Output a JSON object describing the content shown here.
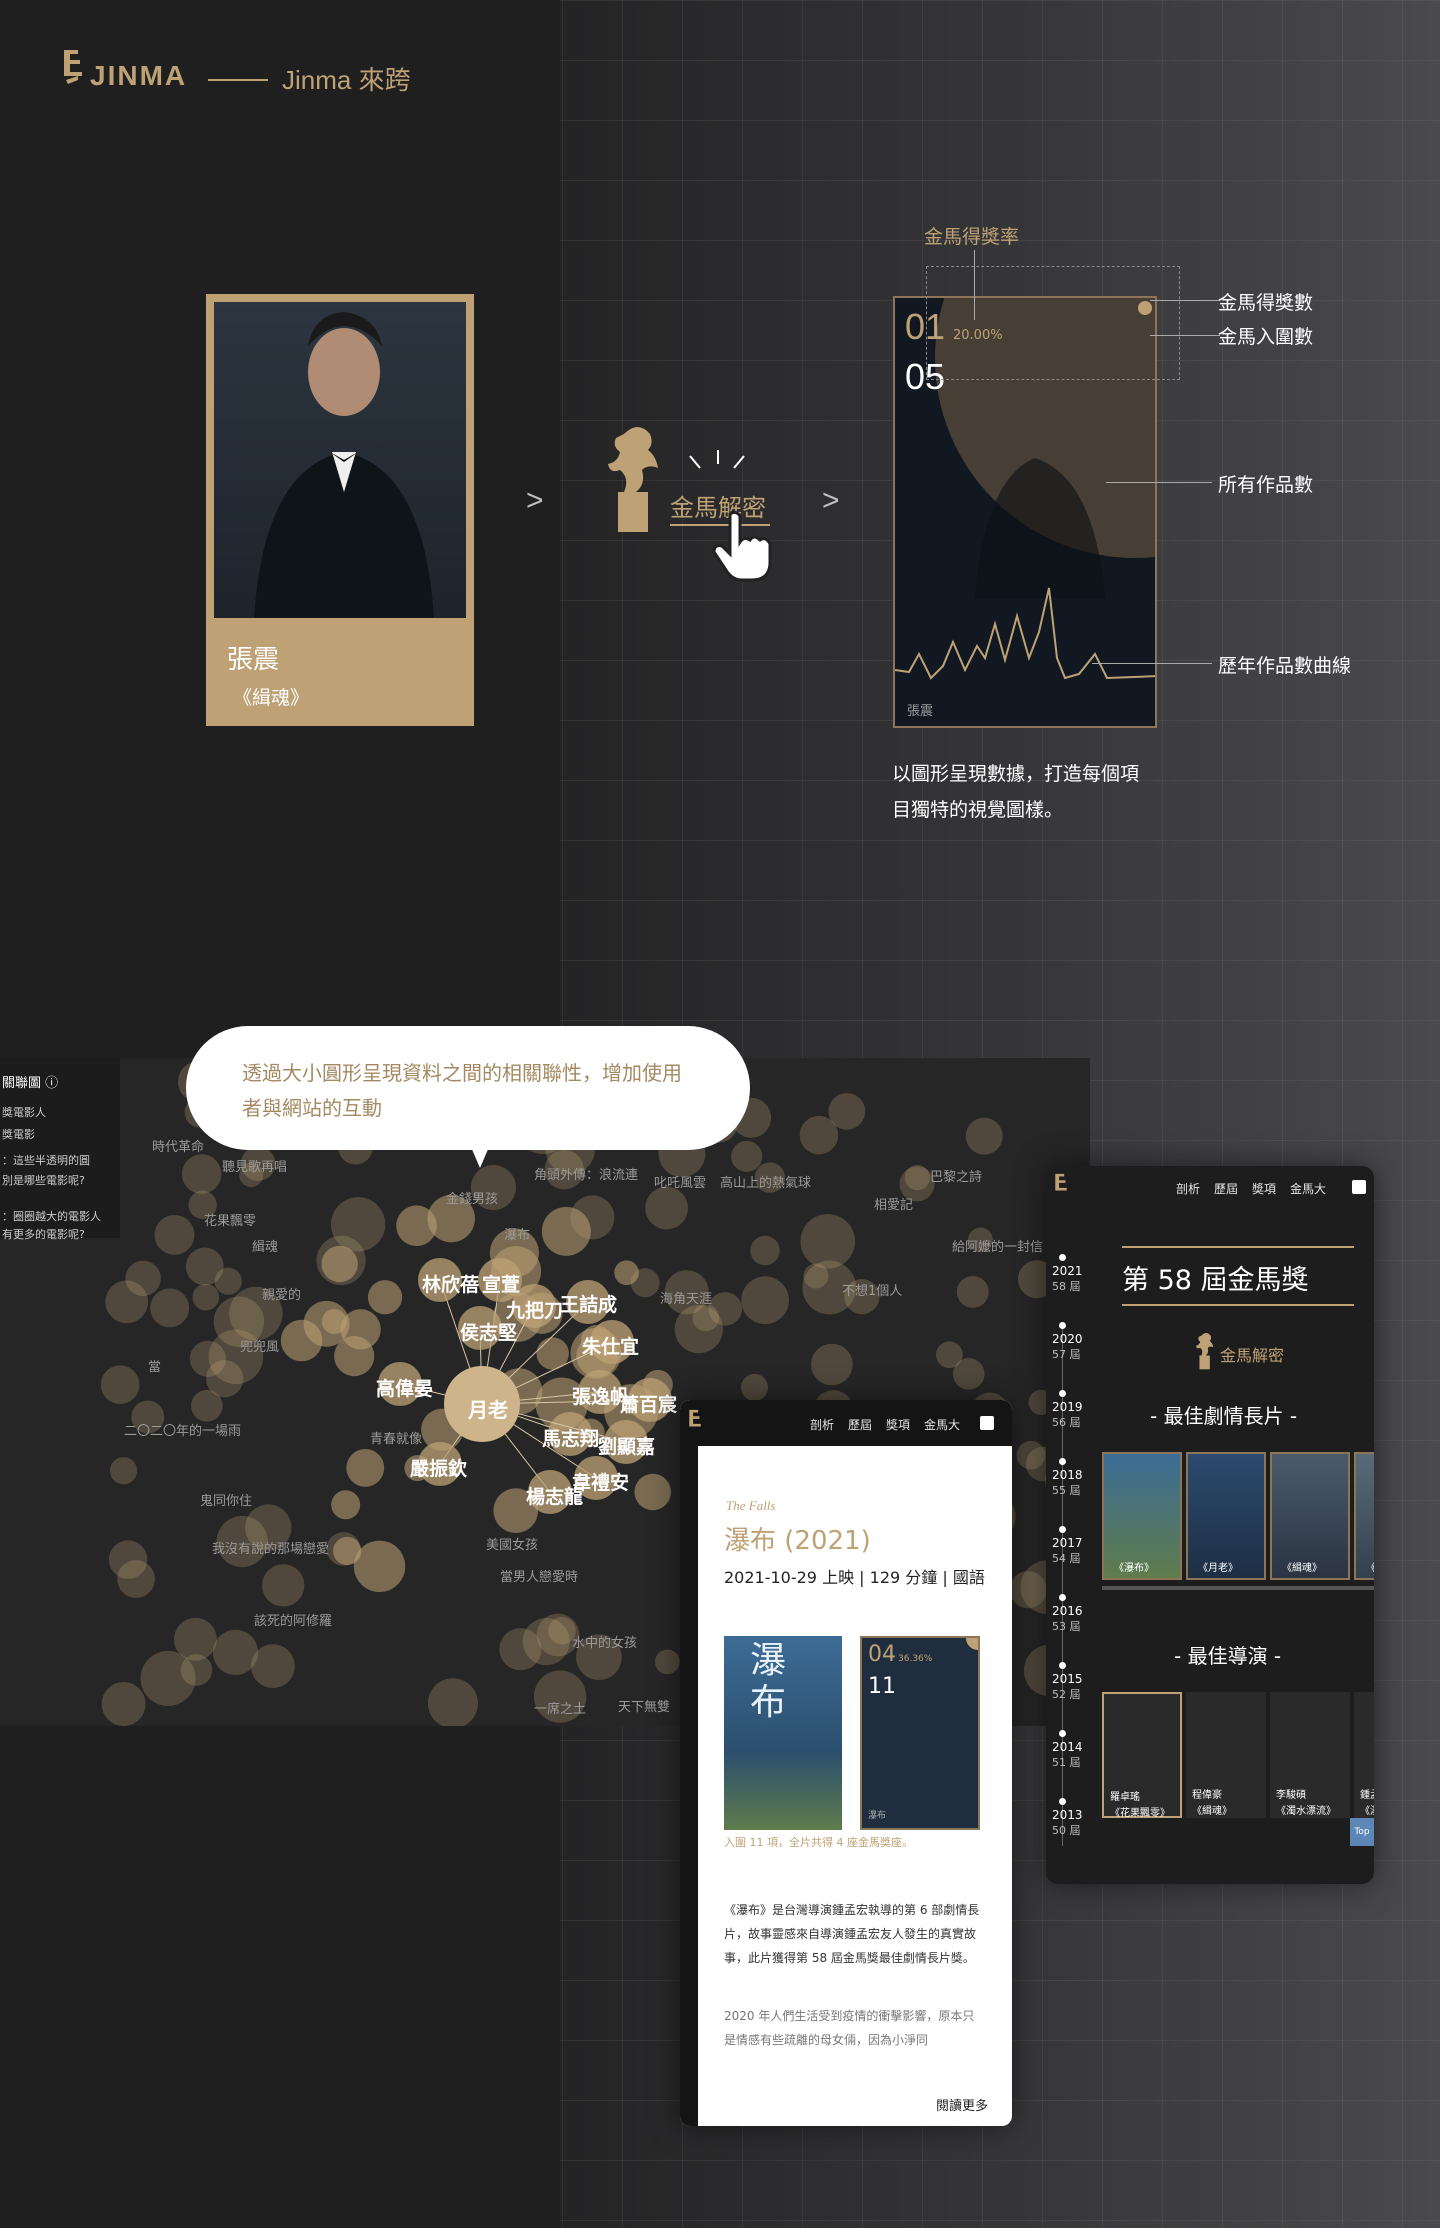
{
  "header": {
    "brand": "JINMA",
    "site_title": "Jinma 來跨"
  },
  "card": {
    "name": "張震",
    "work": "《緝魂》"
  },
  "flow": {
    "arrow": ">",
    "decode_label": "金馬解密"
  },
  "stat_card": {
    "awards": "01",
    "award_rate": "20.00%",
    "nominations": "05",
    "name": "張震"
  },
  "annotations": {
    "award_rate": "金馬得獎率",
    "awards": "金馬得獎數",
    "nominations": "金馬入圍數",
    "works": "所有作品數",
    "curve": "歷年作品數曲線"
  },
  "description": {
    "line1": "以圖形呈現數據，打造每個項",
    "line2": "目獨特的視覺圖樣。"
  },
  "bubble": {
    "line1": "透過大小圓形呈現資料之間的相關聯性，增加使用",
    "line2": "者與網站的互動"
  },
  "network": {
    "panel_title": "關聯圖 ⓘ",
    "panel_items": [
      "獎電影人",
      "獎電影",
      "：這些半透明的圓",
      "別是哪些電影呢?",
      "：圈圈越大的電影人",
      "有更多的電影呢?"
    ],
    "hub": "月老",
    "hot_names": [
      "林欣蓓",
      "宣萱",
      "九把刀",
      "王詰成",
      "侯志堅",
      "朱仕宜",
      "高偉晏",
      "張逸帆",
      "蕭百宸",
      "馬志翔",
      "劉顯嘉",
      "嚴振欽",
      "韋禮安",
      "楊志龍"
    ],
    "faded_titles": [
      "時代革命",
      "聽見歌再唱",
      "金錢男孩",
      "角頭外傳：浪流連",
      "叱吒風雲",
      "高山上的熱氣球",
      "巴黎之詩",
      "相愛記",
      "花果飄零",
      "瀑布",
      "給阿嬤的一封信",
      "緝魂",
      "親愛的",
      "不想1個人",
      "海角天涯",
      "兜兜風",
      "當",
      "二〇二〇年的一場雨",
      "青春就像",
      "鬼同你住",
      "美國女孩",
      "我沒有說的那場戀愛",
      "當男人戀愛時",
      "該死的阿修羅",
      "水中的女孩",
      "一席之土",
      "天下無雙"
    ]
  },
  "phone": {
    "nav": [
      "剖析",
      "歷屆",
      "獎項",
      "金馬大"
    ],
    "en_title": "The Falls",
    "title": "瀑布 (2021)",
    "meta": "2021-10-29 上映 | 129 分鐘 | 國語",
    "poster_text": "瀑布",
    "card_awards": "04",
    "card_rate": "36.36%",
    "card_noms": "11",
    "card_name": "瀑布",
    "note": "入圍 11 項，全片共得 4 座金馬獎座。",
    "body1": "《瀑布》是台灣導演鍾孟宏執導的第 6 部劇情長片，故事靈感來自導演鍾孟宏友人發生的真實故事，此片獲得第 58 屆金馬獎最佳劇情長片獎。",
    "body2": "2020 年人們生活受到疫情的衝擊影響，原本只是情感有些疏離的母女倆，因為小淨同",
    "more": "閱讀更多"
  },
  "tablet": {
    "nav": [
      "剖析",
      "歷屆",
      "獎項",
      "金馬大"
    ],
    "title": "第 58 屆金馬獎",
    "decode": "金馬解密",
    "section1": "- 最佳劇情長片 -",
    "section2": "- 最佳導演 -",
    "posters": [
      "《瀑布》",
      "《月老》",
      "《緝魂》",
      "《濁"
    ],
    "directors": [
      {
        "name": "羅卓瑤",
        "work": "《花果飄零》"
      },
      {
        "name": "程偉豪",
        "work": "《緝魂》"
      },
      {
        "name": "李駿碩",
        "work": "《濁水漂流》"
      },
      {
        "name": "鍾孟",
        "work": "《瀑"
      }
    ],
    "years": [
      {
        "y": "2021",
        "n": "58 屆"
      },
      {
        "y": "2020",
        "n": "57 屆"
      },
      {
        "y": "2019",
        "n": "56 屆"
      },
      {
        "y": "2018",
        "n": "55 屆"
      },
      {
        "y": "2017",
        "n": "54 屆"
      },
      {
        "y": "2016",
        "n": "53 屆"
      },
      {
        "y": "2015",
        "n": "52 屆"
      },
      {
        "y": "2014",
        "n": "51 屆"
      },
      {
        "y": "2013",
        "n": "50 屆"
      }
    ],
    "top_btn": "Top"
  },
  "colors": {
    "gold": "#bea275",
    "dark": "#1f1f20",
    "text": "#ffffff"
  }
}
